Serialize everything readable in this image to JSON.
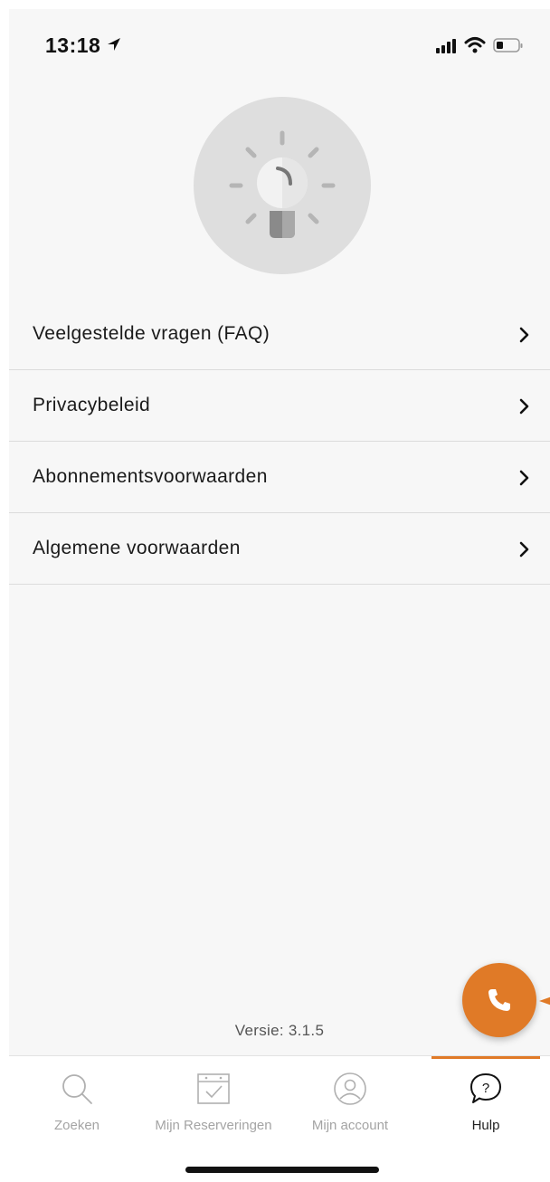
{
  "status_bar": {
    "time": "13:18",
    "icons": [
      "location-arrow-icon",
      "signal-icon",
      "wifi-icon",
      "battery-icon"
    ]
  },
  "hero": {
    "icon": "lightbulb-icon"
  },
  "menu": {
    "items": [
      {
        "label": "Veelgestelde vragen (FAQ)",
        "icon": "chevron-right-icon"
      },
      {
        "label": "Privacybeleid",
        "icon": "chevron-right-icon"
      },
      {
        "label": "Abonnementsvoorwaarden",
        "icon": "chevron-right-icon"
      },
      {
        "label": "Algemene voorwaarden",
        "icon": "chevron-right-icon"
      }
    ]
  },
  "version": {
    "text": "Versie: 3.1.5"
  },
  "fab": {
    "icon": "phone-icon",
    "color": "#e07a27"
  },
  "tab_bar": {
    "active": "Hulp",
    "tabs": [
      {
        "label": "Zoeken",
        "icon": "search-icon"
      },
      {
        "label": "Mijn Reserveringen",
        "icon": "calendar-check-icon"
      },
      {
        "label": "Mijn account",
        "icon": "user-icon"
      },
      {
        "label": "Hulp",
        "icon": "help-bubble-icon"
      }
    ]
  },
  "colors": {
    "accent": "#e07a27",
    "background": "#f7f7f7",
    "inactive_tab": "#a4a4a4"
  }
}
